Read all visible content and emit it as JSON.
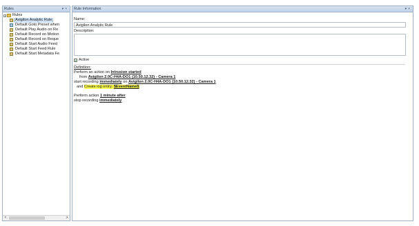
{
  "left_pane": {
    "title": "Rules",
    "pin_icon": "pin-icon",
    "close_icon": "close-icon",
    "root": {
      "expander": "−",
      "label": "Rules"
    },
    "items": [
      {
        "label": "Avigilon Analytic Rule",
        "selected": true
      },
      {
        "label": "Default Goto Preset when"
      },
      {
        "label": "Default Play Audio on Re"
      },
      {
        "label": "Default Record on Motion"
      },
      {
        "label": "Default Record on Reque"
      },
      {
        "label": "Default Start Audio Feed"
      },
      {
        "label": "Default Start Feed Rule"
      },
      {
        "label": "Default Start Metadata Fe"
      }
    ],
    "scroll": {
      "left": "<",
      "right": ">"
    }
  },
  "right_pane": {
    "title": "Rule Information",
    "name_label": "Name:",
    "name_value": "Avigilon Analytic Rule",
    "description_label": "Description:",
    "description_value": "",
    "active_label": "Active",
    "active_check": "☑",
    "definition_label": "Definition:",
    "definition": {
      "l1_prefix": "Perform an action on ",
      "l1_event": "Intrusion started",
      "l2_prefix": "from ",
      "l2_source": "Avigilon 2.0C-H4A-DO1 (10.50.12.32) - Camera 1",
      "l3_prefix": "start recording ",
      "l3_when": "immediately",
      "l3_mid": " on ",
      "l3_target": "Avigilon 2.0C-H4A-DO1 (10.50.12.32) - Camera 1",
      "l4_prefix": "and ",
      "l4_action": "Create log entry: ",
      "l4_token": "$EventName$",
      "l5_prefix": "Perform action ",
      "l5_time": "1 minute after",
      "l6_prefix": "stop recording ",
      "l6_when": "immediately"
    }
  },
  "colors": {
    "header_bg": "#c9d8ea",
    "border": "#9fb0c4",
    "selection": "#cfe2f7",
    "highlight": "#fbfb4e"
  }
}
